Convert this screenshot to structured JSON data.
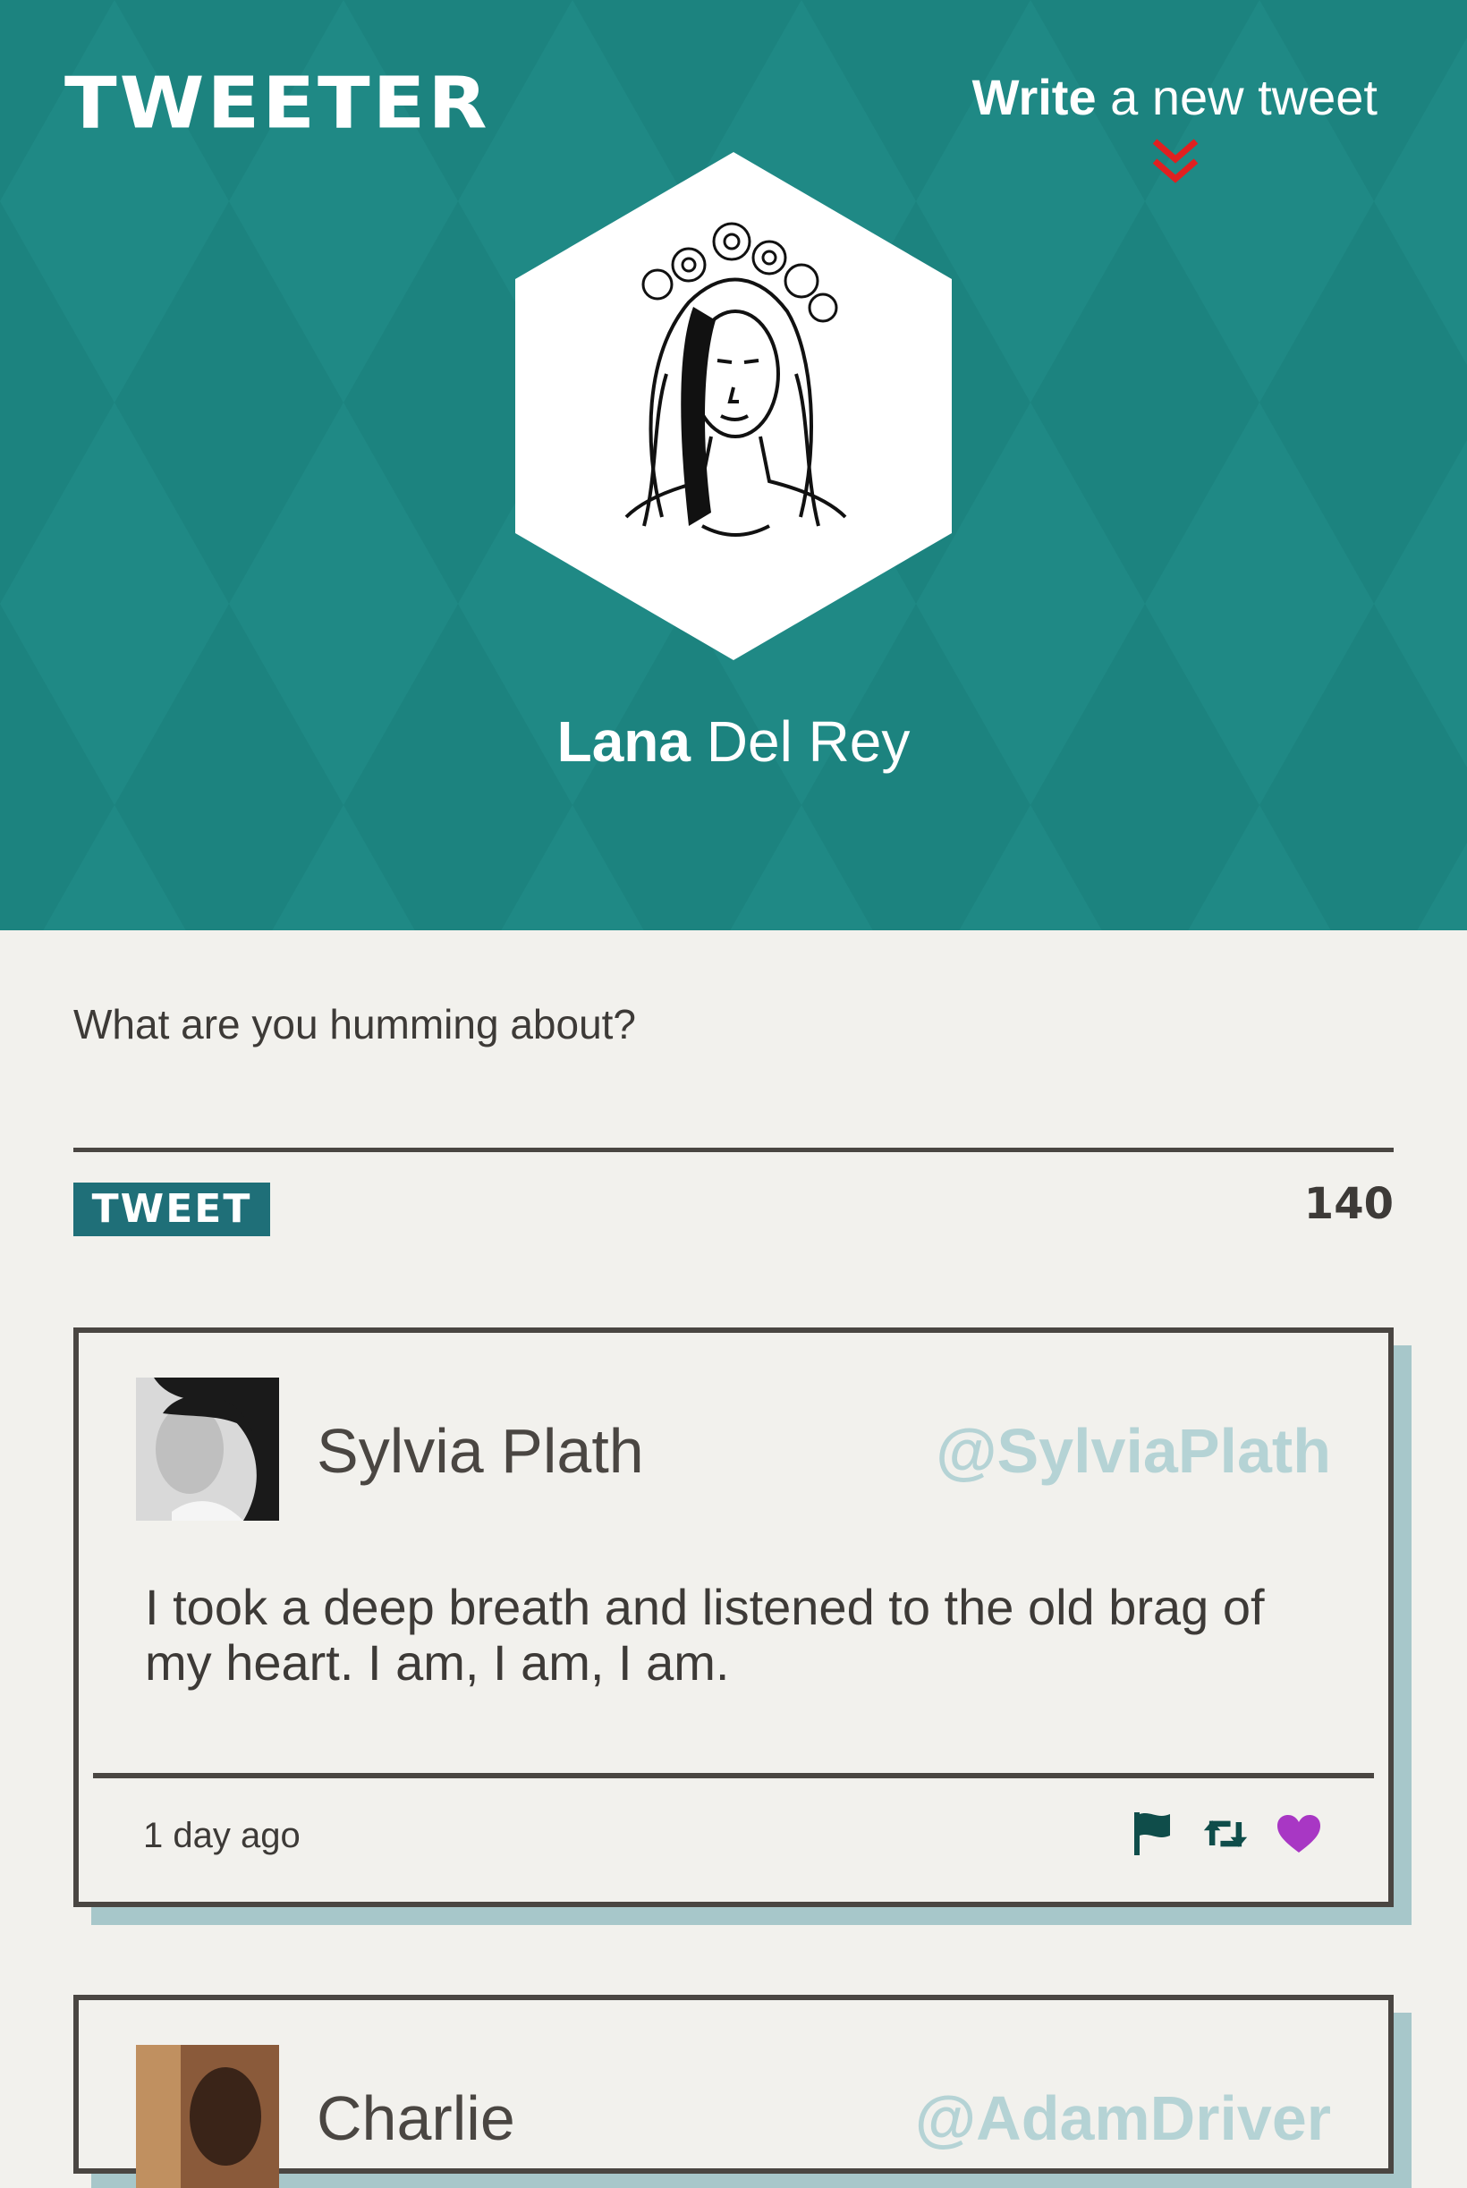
{
  "header": {
    "logo": "TWEETER",
    "write_bold": "Write",
    "write_rest": " a new tweet",
    "profile_first": "Lana",
    "profile_last": " Del Rey",
    "chevron_icon": "double-chevron-down-icon",
    "accent_color": "#e02020"
  },
  "compose": {
    "placeholder": "What are you humming about?",
    "button_label": "TWEET",
    "char_count": "140"
  },
  "tweets": [
    {
      "name": "Sylvia Plath",
      "handle": "@SylviaPlath",
      "text": "I took a deep breath and listened to the old brag of my heart. I am, I am, I am.",
      "time": "1 day ago",
      "actions": [
        "flag-icon",
        "retweet-icon",
        "heart-icon"
      ]
    },
    {
      "name": "Charlie",
      "handle": "@AdamDriver"
    }
  ],
  "colors": {
    "header_bg": "#1f8985",
    "button_bg": "#1f6f78",
    "handle": "#b5d3d5",
    "heart": "#a837c4",
    "icon": "#0f4d4a"
  }
}
